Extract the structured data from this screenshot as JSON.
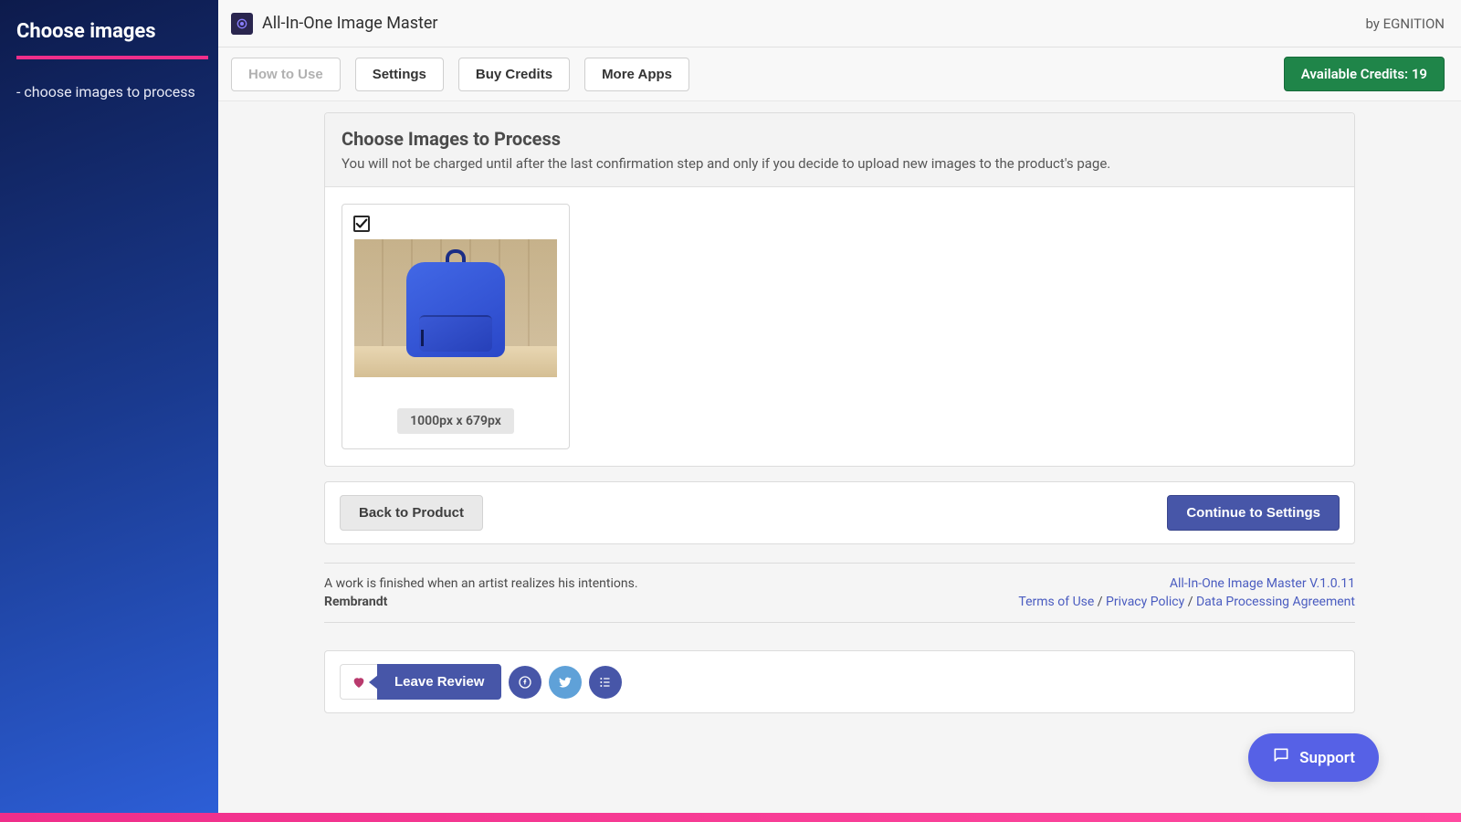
{
  "sidebar": {
    "title": "Choose images",
    "step": "- choose images to process"
  },
  "topbar": {
    "app_title": "All-In-One Image Master",
    "by_vendor": "by EGNITION"
  },
  "toolbar": {
    "how_to_use": "How to Use",
    "settings": "Settings",
    "buy_credits": "Buy Credits",
    "more_apps": "More Apps",
    "credits_label": "Available Credits: 19"
  },
  "choose_panel": {
    "title": "Choose Images to Process",
    "description": "You will not be charged until after the last confirmation step and only if you decide to upload new images to the product's page."
  },
  "images": [
    {
      "checked": true,
      "dimensions": "1000px x 679px"
    }
  ],
  "actions": {
    "back": "Back to Product",
    "continue": "Continue to Settings"
  },
  "footer": {
    "quote": "A work is finished when an artist realizes his intentions.",
    "author": "Rembrandt",
    "version": "All-In-One Image Master V.1.0.11",
    "terms": "Terms of Use",
    "privacy": "Privacy Policy",
    "dpa": "Data Processing Agreement",
    "sep": " / "
  },
  "social": {
    "review": "Leave Review"
  },
  "support": {
    "label": "Support"
  }
}
